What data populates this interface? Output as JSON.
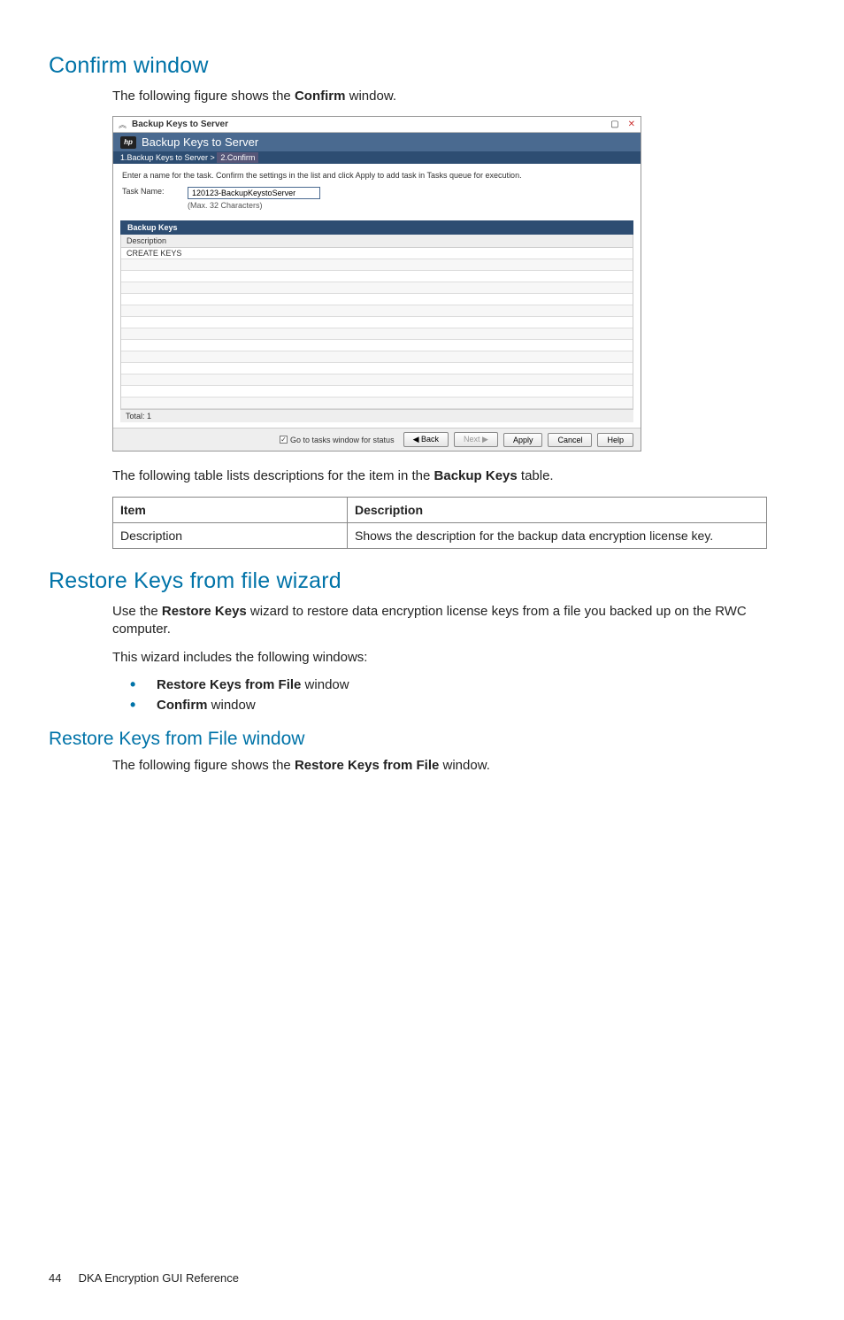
{
  "section1": {
    "title": "Confirm window",
    "intro_pre": "The following figure shows the ",
    "intro_bold": "Confirm",
    "intro_post": " window."
  },
  "shot": {
    "titlebar": "Backup Keys to Server",
    "header": "Backup Keys to Server",
    "crumb1": "1.Backup Keys to Server  >",
    "crumb2": "2.Confirm",
    "instruction": "Enter a name for the task. Confirm the settings in the list and click Apply to add task in Tasks queue for execution.",
    "task_label": "Task Name:",
    "task_value": "120123-BackupKeystoServer",
    "task_hint": "(Max. 32 Characters)",
    "tab": "Backup Keys",
    "col_desc": "Description",
    "row0": "CREATE KEYS",
    "total": "Total: 1",
    "chk_label": "Go to tasks window for status",
    "btn_back": "◀ Back",
    "btn_next": "Next ▶",
    "btn_apply": "Apply",
    "btn_cancel": "Cancel",
    "btn_help": "Help"
  },
  "table_intro_pre": "The following table lists descriptions for the item in the ",
  "table_intro_bold": "Backup Keys",
  "table_intro_post": " table.",
  "desc_table": {
    "h1": "Item",
    "h2": "Description",
    "r1c1": "Description",
    "r1c2": "Shows the description for the backup data encryption license key."
  },
  "section2": {
    "title": "Restore Keys from file wizard",
    "p1_pre": "Use the ",
    "p1_bold": "Restore Keys",
    "p1_post": " wizard to restore data encryption license keys from a file you backed up on the RWC computer.",
    "p2": "This wizard includes the following windows:",
    "b1_bold": "Restore Keys from File",
    "b1_post": " window",
    "b2_bold": "Confirm",
    "b2_post": " window"
  },
  "section3": {
    "title": "Restore Keys from File window",
    "intro_pre": "The following figure shows the ",
    "intro_bold": "Restore Keys from File",
    "intro_post": " window."
  },
  "footer": {
    "page": "44",
    "text": "DKA Encryption GUI Reference"
  }
}
